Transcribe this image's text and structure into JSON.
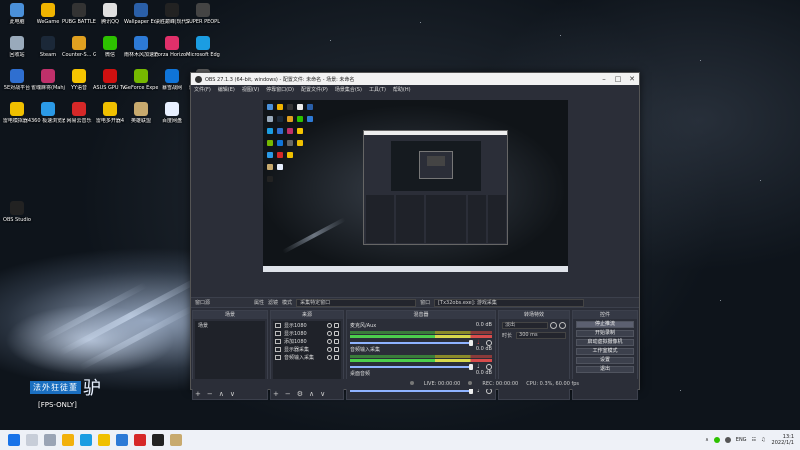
{
  "desktop_icons": [
    {
      "label": "此电脑",
      "icon": "this-pc-icon",
      "color": "#4a90d9"
    },
    {
      "label": "WeGame",
      "icon": "wegame-icon",
      "color": "#f0b400"
    },
    {
      "label": "PUBG BATTLEGR...",
      "icon": "pubg-icon",
      "color": "#333333"
    },
    {
      "label": "腾讯QQ",
      "icon": "qq-icon",
      "color": "#e0e0e0"
    },
    {
      "label": "Wallpaper Engine:...",
      "icon": "wallpaper-engine-icon",
      "color": "#2a5fa8"
    },
    {
      "label": "决胜巅峰|现代战争",
      "icon": "game-icon",
      "color": "#222222"
    },
    {
      "label": "SUPER PEOPLE CBT",
      "icon": "super-people-icon",
      "color": "#444444"
    },
    {
      "label": "回收站",
      "icon": "recycle-bin-icon",
      "color": "#9ab"
    },
    {
      "label": "Steam",
      "icon": "steam-icon",
      "color": "#1b2838"
    },
    {
      "label": "Counter-S... Global Off...",
      "icon": "csgo-icon",
      "color": "#e0a020"
    },
    {
      "label": "微信",
      "icon": "wechat-icon",
      "color": "#2dc100"
    },
    {
      "label": "雨林木风加速器5.0",
      "icon": "accelerator-icon",
      "color": "#2d7ad6"
    },
    {
      "label": "Forza Horizon 5",
      "icon": "forza-icon",
      "color": "#e0306a"
    },
    {
      "label": "Microsoft Edge",
      "icon": "edge-icon",
      "color": "#1b9de2"
    },
    {
      "label": "5E对战平台",
      "icon": "5e-icon",
      "color": "#2f6fd0"
    },
    {
      "label": "雀魂麻将(Mahjong...",
      "icon": "mahjong-icon",
      "color": "#c0306a"
    },
    {
      "label": "YY语音",
      "icon": "yy-icon",
      "color": "#f5c400"
    },
    {
      "label": "ASUS GPU Tweakll",
      "icon": "asus-icon",
      "color": "#d01010"
    },
    {
      "label": "GeForce Experience",
      "icon": "geforce-icon",
      "color": "#76b900"
    },
    {
      "label": "暴雪战网",
      "icon": "battlenet-icon",
      "color": "#0f74d8"
    },
    {
      "label": "炫斗城传奇4",
      "icon": "game2-icon",
      "color": "#666666"
    },
    {
      "label": "雷电模拟器4",
      "icon": "ldplayer-icon",
      "color": "#f0c000"
    },
    {
      "label": "360 极速浏览器X",
      "icon": "360-browser-icon",
      "color": "#2b9ae6"
    },
    {
      "label": "网易云音乐",
      "icon": "netease-music-icon",
      "color": "#d62828"
    },
    {
      "label": "雷电多开器4",
      "icon": "ldmulti-icon",
      "color": "#f0c000"
    },
    {
      "label": "英雄联盟",
      "icon": "lol-icon",
      "color": "#c8aa6e"
    },
    {
      "label": "百度网盘",
      "icon": "baidu-netdisk-icon",
      "color": "#e8f0ff"
    },
    {
      "label": "OBS Studio",
      "icon": "obs-icon",
      "color": "#222222"
    }
  ],
  "watermark": {
    "line1": "法外狂徒董",
    "big": "驴",
    "line2": "[FPS-ONLY]"
  },
  "obs": {
    "title": "OBS 27.1.3 (64-bit, windows) - 配置文件: 未命名 - 场景: 未命名",
    "menu": [
      "文件(F)",
      "编辑(E)",
      "视图(V)",
      "停靠窗口(D)",
      "配置文件(P)",
      "场景集合(S)",
      "工具(T)",
      "帮助(H)"
    ],
    "source_toolbar": {
      "no_source": "窗口源",
      "properties": "属性",
      "filters": "滤镜",
      "mode_label": "模式",
      "mode_value": "采集特定窗口",
      "window_label": "窗口",
      "window_value": "[Tx32obs.exe]: 游戏采集"
    },
    "scenes": {
      "title": "场景",
      "items": [
        "场景"
      ]
    },
    "sources": {
      "title": "来源",
      "items": [
        {
          "name": "显示1080",
          "icon": "display-icon"
        },
        {
          "name": "显示1080",
          "icon": "display-icon"
        },
        {
          "name": "添加1080",
          "icon": "window-icon"
        },
        {
          "name": "显示器采集",
          "icon": "monitor-icon"
        },
        {
          "name": "音频输入采集",
          "icon": "mic-icon"
        }
      ]
    },
    "mixer": {
      "title": "混音器",
      "channels": [
        {
          "name": "麦克风/Aux",
          "db": "0.0 dB",
          "muted": true
        },
        {
          "name": "音频输入采集",
          "db": "0.0 dB",
          "muted": false
        },
        {
          "name": "桌面音频",
          "db": "0.0 dB",
          "muted": false
        }
      ]
    },
    "transitions": {
      "title": "转场特效",
      "type": "淡出",
      "duration_label": "时长",
      "duration_value": "300 ms"
    },
    "controls": {
      "title": "控件",
      "buttons": [
        "停止推流",
        "开始录制",
        "启动虚拟摄像机",
        "工作室模式",
        "设置",
        "退出"
      ]
    },
    "status": {
      "live": "LIVE: 00:00:00",
      "rec": "REC: 00:00:00",
      "cpu": "CPU: 0.3%, 60.00 fps"
    }
  },
  "taskbar": {
    "tray_lang": "ENG",
    "time": "13:1",
    "date": "2022/1/1"
  }
}
